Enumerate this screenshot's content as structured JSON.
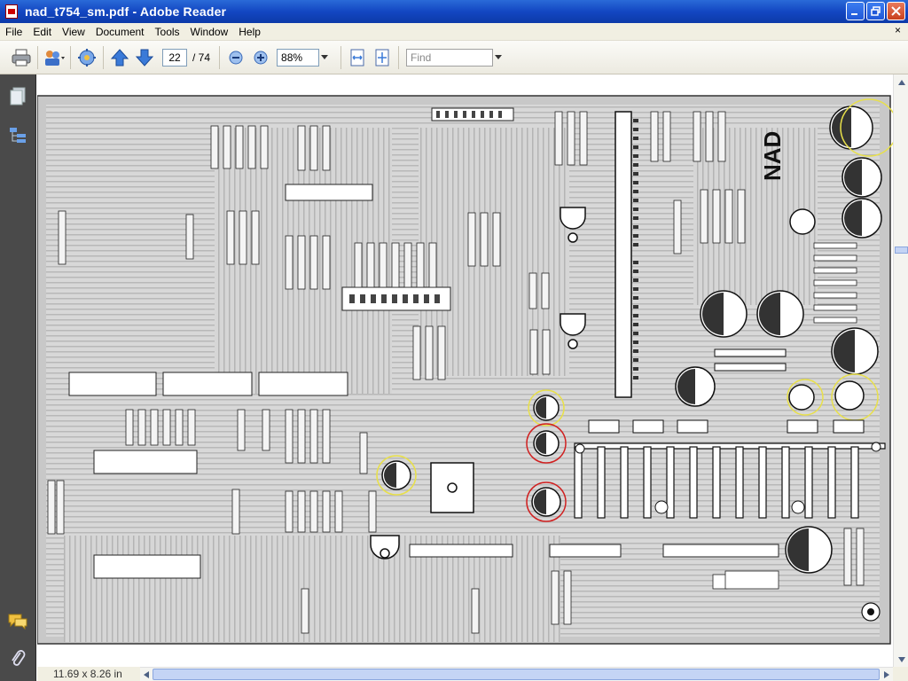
{
  "window": {
    "title": "nad_t754_sm.pdf - Adobe Reader",
    "minimize": "minimize",
    "maximize": "restore",
    "close": "close"
  },
  "menu": {
    "items": [
      "File",
      "Edit",
      "View",
      "Document",
      "Tools",
      "Window",
      "Help"
    ],
    "close_symbol": "×"
  },
  "toolbar": {
    "current_page": "22",
    "page_separator": "/ 74",
    "zoom": "88%",
    "find_placeholder": "Find"
  },
  "status": {
    "page_size": "11.69 x 8.26 in"
  },
  "document": {
    "brand": "NAD"
  },
  "colors": {
    "titlebar": "#1347c2",
    "menubar": "#f1efe2",
    "navpane": "#4a4a4a",
    "highlight_yellow": "#e8e04a",
    "highlight_red": "#d02020"
  }
}
